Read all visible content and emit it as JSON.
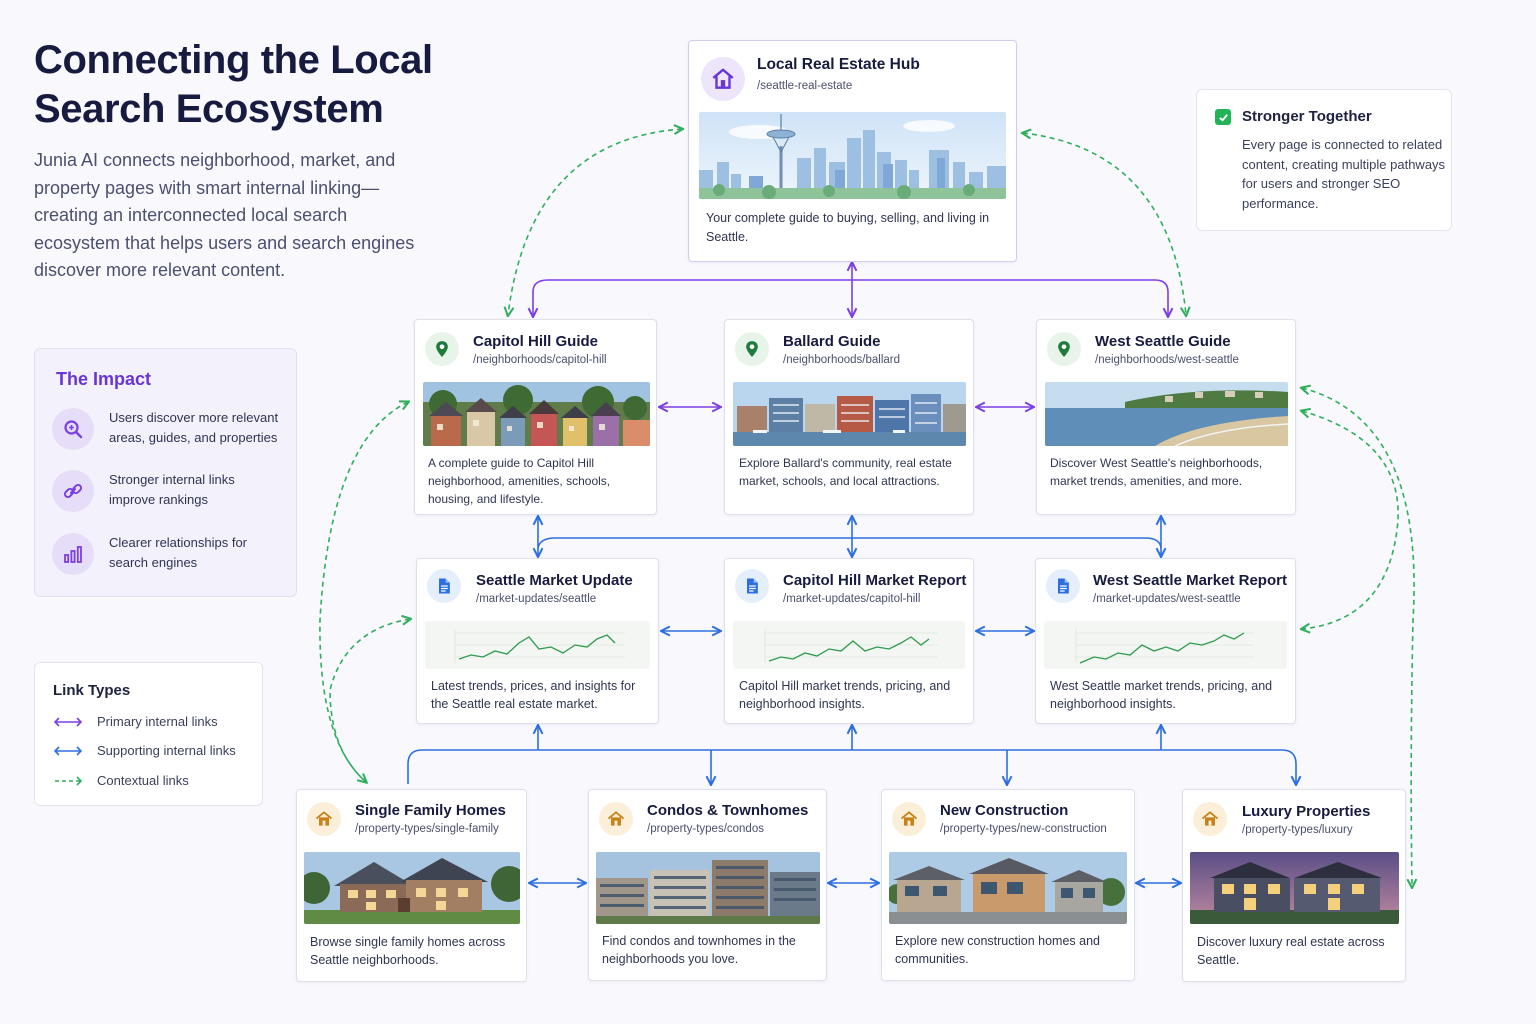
{
  "header": {
    "title": "Connecting the Local Search Ecosystem",
    "intro": "Junia AI connects neighborhood, market, and property pages with smart internal linking—creating an interconnected local search ecosystem that helps users and search engines discover more relevant content."
  },
  "impact": {
    "title": "The Impact",
    "items": [
      {
        "icon": "magnifier-icon",
        "text": "Users discover more relevant areas, guides, and properties"
      },
      {
        "icon": "link-icon",
        "text": "Stronger internal links improve rankings"
      },
      {
        "icon": "bar-chart-icon",
        "text": "Clearer relationships for search engines"
      }
    ]
  },
  "link_types": {
    "title": "Link Types",
    "items": [
      {
        "label": "Primary internal links",
        "color": "#7b3fe4",
        "style": "solid"
      },
      {
        "label": "Supporting internal links",
        "color": "#2d6fe0",
        "style": "solid"
      },
      {
        "label": "Contextual links",
        "color": "#2fae5c",
        "style": "dashed"
      }
    ]
  },
  "callout": {
    "icon": "checkbox-icon",
    "title": "Stronger Together",
    "text": "Every page is connected to related content, creating multiple pathways for users and stronger SEO performance."
  },
  "hub": {
    "title": "Local Real Estate Hub",
    "url": "/seattle-real-estate",
    "icon": "house-icon",
    "image": "seattle-skyline-illustration",
    "description": "Your complete guide to buying, selling, and living in Seattle."
  },
  "neighborhoods": [
    {
      "title": "Capitol Hill Guide",
      "url": "/neighborhoods/capitol-hill",
      "icon": "map-pin-icon",
      "image": "capitol-hill-houses-photo",
      "description": "A complete guide to Capitol Hill neighborhood, amenities, schools, housing, and lifestyle."
    },
    {
      "title": "Ballard Guide",
      "url": "/neighborhoods/ballard",
      "icon": "map-pin-icon",
      "image": "ballard-waterfront-photo",
      "description": "Explore Ballard's community, real estate market, schools, and local attractions."
    },
    {
      "title": "West Seattle Guide",
      "url": "/neighborhoods/west-seattle",
      "icon": "map-pin-icon",
      "image": "west-seattle-beach-photo",
      "description": "Discover West Seattle's neighborhoods, market trends, amenities, and more."
    }
  ],
  "markets": [
    {
      "title": "Seattle Market Update",
      "url": "/market-updates/seattle",
      "icon": "document-icon",
      "image": "market-trend-chart",
      "description": "Latest trends, prices, and insights for the Seattle real estate market."
    },
    {
      "title": "Capitol Hill Market Report",
      "url": "/market-updates/capitol-hill",
      "icon": "document-icon",
      "image": "market-trend-chart",
      "description": "Capitol Hill market trends, pricing, and neighborhood insights."
    },
    {
      "title": "West Seattle Market Report",
      "url": "/market-updates/west-seattle",
      "icon": "document-icon",
      "image": "market-trend-chart",
      "description": "West Seattle market trends, pricing, and neighborhood insights."
    }
  ],
  "properties": [
    {
      "title": "Single Family Homes",
      "url": "/property-types/single-family",
      "icon": "house-icon",
      "image": "single-family-home-photo",
      "description": "Browse single family homes across Seattle neighborhoods."
    },
    {
      "title": "Condos & Townhomes",
      "url": "/property-types/condos",
      "icon": "house-icon",
      "image": "condo-building-photo",
      "description": "Find condos and townhomes in the neighborhoods you love."
    },
    {
      "title": "New Construction",
      "url": "/property-types/new-construction",
      "icon": "house-icon",
      "image": "new-construction-photo",
      "description": "Explore new construction homes and communities."
    },
    {
      "title": "Luxury Properties",
      "url": "/property-types/luxury",
      "icon": "house-icon",
      "image": "luxury-home-photo",
      "description": "Discover luxury real estate across Seattle."
    }
  ],
  "colors": {
    "primary_link": "#7b3fe4",
    "supporting_link": "#2d6fe0",
    "contextual_link": "#2fae5c",
    "neighborhood_accent": "#1e7b3a",
    "market_accent": "#2d6fe0",
    "property_accent": "#c9821a"
  }
}
